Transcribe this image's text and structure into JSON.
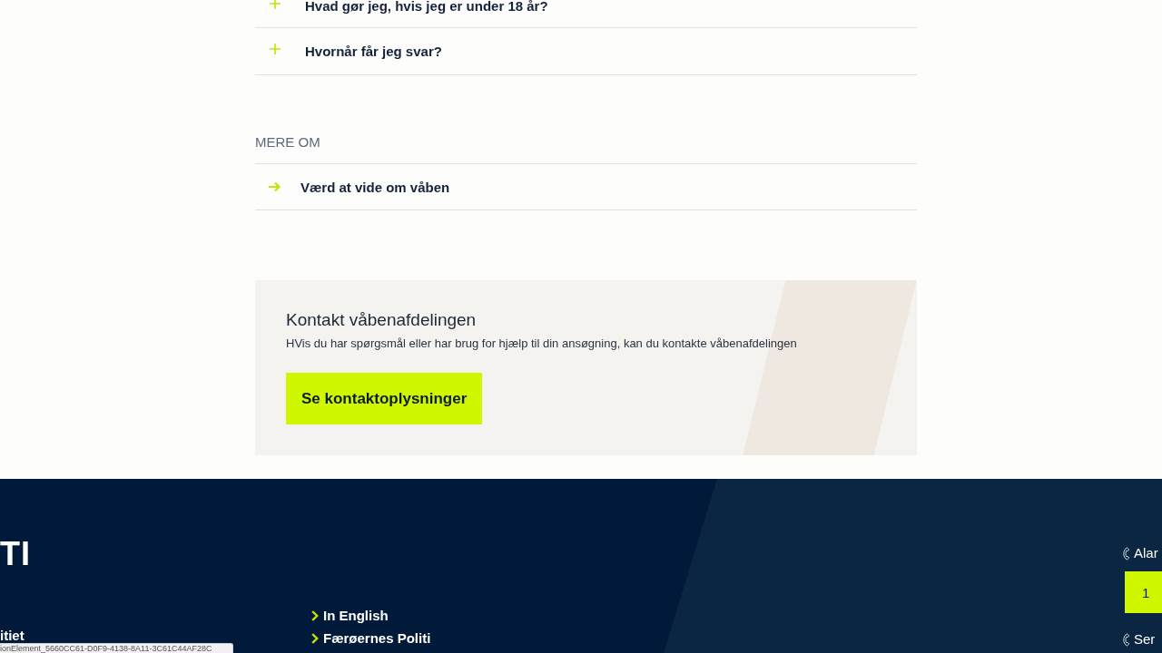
{
  "faq": {
    "items": [
      {
        "question": "Hvad gør jeg, hvis jeg er under 18 år?",
        "expanded": false
      },
      {
        "question": "Hvornår får jeg svar?",
        "expanded": false
      }
    ]
  },
  "more_about": {
    "heading": "MERE OM",
    "links": [
      "Værd at vide om våben"
    ]
  },
  "contact": {
    "title": "Kontakt våbenafdelingen",
    "text": "HVis du har spørgsmål eller har brug for hjælp til din ansøgning, kan du kontakte våbenafdelingen",
    "button": "Se kontaktoplysninger"
  },
  "footer": {
    "logo": "TI",
    "side_links": [
      "itiet"
    ],
    "links": [
      "In English",
      "Færøernes Politi"
    ],
    "contacts": [
      {
        "label": "Alar",
        "number": "1"
      },
      {
        "label": "Ser"
      }
    ]
  },
  "status_tooltip": "ionElement_5660CC61-D0F9-4138-8A11-3C61C44AF28C"
}
